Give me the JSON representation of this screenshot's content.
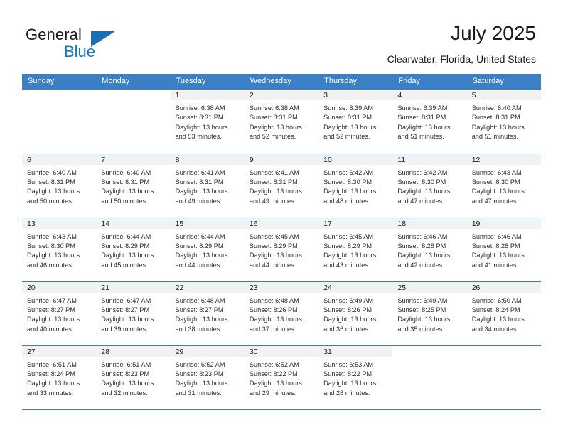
{
  "brand": {
    "name_part1": "General",
    "name_part2": "Blue",
    "logo_icon": "triangle-logo-icon"
  },
  "header": {
    "title": "July 2025",
    "subtitle": "Clearwater, Florida, United States"
  },
  "colors": {
    "header_blue": "#3b7fc4",
    "brand_blue": "#1b76bd",
    "daynum_band": "#f2f2f2",
    "text": "#1a1a1a"
  },
  "weekday_headers": [
    "Sunday",
    "Monday",
    "Tuesday",
    "Wednesday",
    "Thursday",
    "Friday",
    "Saturday"
  ],
  "weeks": [
    [
      {
        "day": "",
        "sunrise": "",
        "sunset": "",
        "daylight1": "",
        "daylight2": ""
      },
      {
        "day": "",
        "sunrise": "",
        "sunset": "",
        "daylight1": "",
        "daylight2": ""
      },
      {
        "day": "1",
        "sunrise": "Sunrise: 6:38 AM",
        "sunset": "Sunset: 8:31 PM",
        "daylight1": "Daylight: 13 hours",
        "daylight2": "and 53 minutes."
      },
      {
        "day": "2",
        "sunrise": "Sunrise: 6:38 AM",
        "sunset": "Sunset: 8:31 PM",
        "daylight1": "Daylight: 13 hours",
        "daylight2": "and 52 minutes."
      },
      {
        "day": "3",
        "sunrise": "Sunrise: 6:39 AM",
        "sunset": "Sunset: 8:31 PM",
        "daylight1": "Daylight: 13 hours",
        "daylight2": "and 52 minutes."
      },
      {
        "day": "4",
        "sunrise": "Sunrise: 6:39 AM",
        "sunset": "Sunset: 8:31 PM",
        "daylight1": "Daylight: 13 hours",
        "daylight2": "and 51 minutes."
      },
      {
        "day": "5",
        "sunrise": "Sunrise: 6:40 AM",
        "sunset": "Sunset: 8:31 PM",
        "daylight1": "Daylight: 13 hours",
        "daylight2": "and 51 minutes."
      }
    ],
    [
      {
        "day": "6",
        "sunrise": "Sunrise: 6:40 AM",
        "sunset": "Sunset: 8:31 PM",
        "daylight1": "Daylight: 13 hours",
        "daylight2": "and 50 minutes."
      },
      {
        "day": "7",
        "sunrise": "Sunrise: 6:40 AM",
        "sunset": "Sunset: 8:31 PM",
        "daylight1": "Daylight: 13 hours",
        "daylight2": "and 50 minutes."
      },
      {
        "day": "8",
        "sunrise": "Sunrise: 6:41 AM",
        "sunset": "Sunset: 8:31 PM",
        "daylight1": "Daylight: 13 hours",
        "daylight2": "and 49 minutes."
      },
      {
        "day": "9",
        "sunrise": "Sunrise: 6:41 AM",
        "sunset": "Sunset: 8:31 PM",
        "daylight1": "Daylight: 13 hours",
        "daylight2": "and 49 minutes."
      },
      {
        "day": "10",
        "sunrise": "Sunrise: 6:42 AM",
        "sunset": "Sunset: 8:30 PM",
        "daylight1": "Daylight: 13 hours",
        "daylight2": "and 48 minutes."
      },
      {
        "day": "11",
        "sunrise": "Sunrise: 6:42 AM",
        "sunset": "Sunset: 8:30 PM",
        "daylight1": "Daylight: 13 hours",
        "daylight2": "and 47 minutes."
      },
      {
        "day": "12",
        "sunrise": "Sunrise: 6:43 AM",
        "sunset": "Sunset: 8:30 PM",
        "daylight1": "Daylight: 13 hours",
        "daylight2": "and 47 minutes."
      }
    ],
    [
      {
        "day": "13",
        "sunrise": "Sunrise: 6:43 AM",
        "sunset": "Sunset: 8:30 PM",
        "daylight1": "Daylight: 13 hours",
        "daylight2": "and 46 minutes."
      },
      {
        "day": "14",
        "sunrise": "Sunrise: 6:44 AM",
        "sunset": "Sunset: 8:29 PM",
        "daylight1": "Daylight: 13 hours",
        "daylight2": "and 45 minutes."
      },
      {
        "day": "15",
        "sunrise": "Sunrise: 6:44 AM",
        "sunset": "Sunset: 8:29 PM",
        "daylight1": "Daylight: 13 hours",
        "daylight2": "and 44 minutes."
      },
      {
        "day": "16",
        "sunrise": "Sunrise: 6:45 AM",
        "sunset": "Sunset: 8:29 PM",
        "daylight1": "Daylight: 13 hours",
        "daylight2": "and 44 minutes."
      },
      {
        "day": "17",
        "sunrise": "Sunrise: 6:45 AM",
        "sunset": "Sunset: 8:29 PM",
        "daylight1": "Daylight: 13 hours",
        "daylight2": "and 43 minutes."
      },
      {
        "day": "18",
        "sunrise": "Sunrise: 6:46 AM",
        "sunset": "Sunset: 8:28 PM",
        "daylight1": "Daylight: 13 hours",
        "daylight2": "and 42 minutes."
      },
      {
        "day": "19",
        "sunrise": "Sunrise: 6:46 AM",
        "sunset": "Sunset: 8:28 PM",
        "daylight1": "Daylight: 13 hours",
        "daylight2": "and 41 minutes."
      }
    ],
    [
      {
        "day": "20",
        "sunrise": "Sunrise: 6:47 AM",
        "sunset": "Sunset: 8:27 PM",
        "daylight1": "Daylight: 13 hours",
        "daylight2": "and 40 minutes."
      },
      {
        "day": "21",
        "sunrise": "Sunrise: 6:47 AM",
        "sunset": "Sunset: 8:27 PM",
        "daylight1": "Daylight: 13 hours",
        "daylight2": "and 39 minutes."
      },
      {
        "day": "22",
        "sunrise": "Sunrise: 6:48 AM",
        "sunset": "Sunset: 8:27 PM",
        "daylight1": "Daylight: 13 hours",
        "daylight2": "and 38 minutes."
      },
      {
        "day": "23",
        "sunrise": "Sunrise: 6:48 AM",
        "sunset": "Sunset: 8:26 PM",
        "daylight1": "Daylight: 13 hours",
        "daylight2": "and 37 minutes."
      },
      {
        "day": "24",
        "sunrise": "Sunrise: 6:49 AM",
        "sunset": "Sunset: 8:26 PM",
        "daylight1": "Daylight: 13 hours",
        "daylight2": "and 36 minutes."
      },
      {
        "day": "25",
        "sunrise": "Sunrise: 6:49 AM",
        "sunset": "Sunset: 8:25 PM",
        "daylight1": "Daylight: 13 hours",
        "daylight2": "and 35 minutes."
      },
      {
        "day": "26",
        "sunrise": "Sunrise: 6:50 AM",
        "sunset": "Sunset: 8:24 PM",
        "daylight1": "Daylight: 13 hours",
        "daylight2": "and 34 minutes."
      }
    ],
    [
      {
        "day": "27",
        "sunrise": "Sunrise: 6:51 AM",
        "sunset": "Sunset: 8:24 PM",
        "daylight1": "Daylight: 13 hours",
        "daylight2": "and 33 minutes."
      },
      {
        "day": "28",
        "sunrise": "Sunrise: 6:51 AM",
        "sunset": "Sunset: 8:23 PM",
        "daylight1": "Daylight: 13 hours",
        "daylight2": "and 32 minutes."
      },
      {
        "day": "29",
        "sunrise": "Sunrise: 6:52 AM",
        "sunset": "Sunset: 8:23 PM",
        "daylight1": "Daylight: 13 hours",
        "daylight2": "and 31 minutes."
      },
      {
        "day": "30",
        "sunrise": "Sunrise: 6:52 AM",
        "sunset": "Sunset: 8:22 PM",
        "daylight1": "Daylight: 13 hours",
        "daylight2": "and 29 minutes."
      },
      {
        "day": "31",
        "sunrise": "Sunrise: 6:53 AM",
        "sunset": "Sunset: 8:22 PM",
        "daylight1": "Daylight: 13 hours",
        "daylight2": "and 28 minutes."
      },
      {
        "day": "",
        "sunrise": "",
        "sunset": "",
        "daylight1": "",
        "daylight2": ""
      },
      {
        "day": "",
        "sunrise": "",
        "sunset": "",
        "daylight1": "",
        "daylight2": ""
      }
    ]
  ]
}
